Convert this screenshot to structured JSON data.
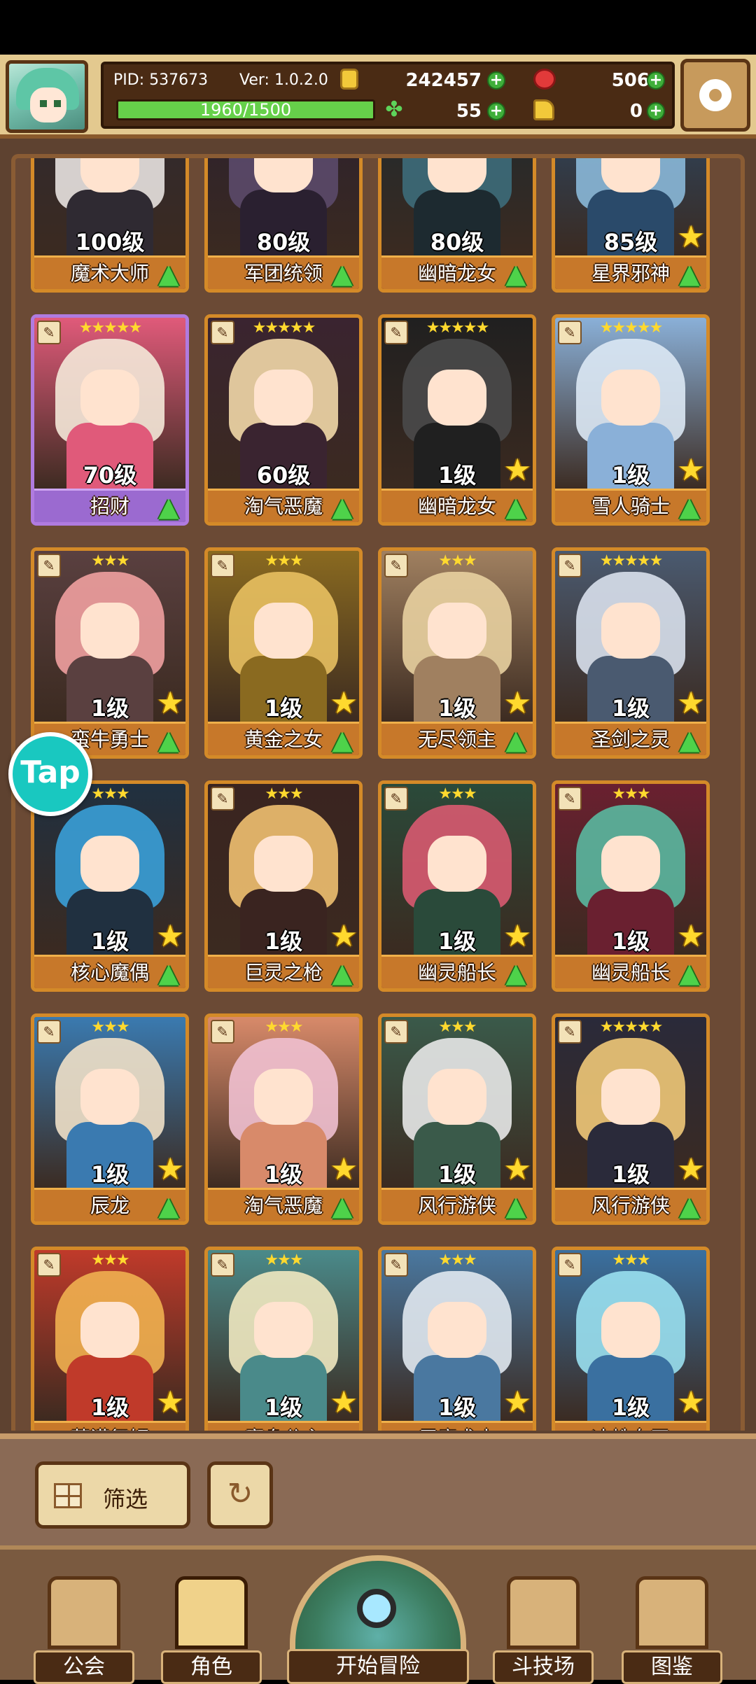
{
  "header": {
    "pid": "PID: 537673",
    "version": "Ver: 1.0.2.0",
    "gold": "242457",
    "gems": "506",
    "exp_text": "1960/1500",
    "exp_progress": 1.0,
    "clover": "55",
    "hand": "0",
    "icons": [
      "gold-coin-icon",
      "red-gem-icon",
      "clover-icon",
      "hand-icon",
      "settings-gear-icon"
    ]
  },
  "cards": [
    {
      "level": "100级",
      "name": "魔术大师",
      "stars": "",
      "colors": [
        "#e8e2e0",
        "#2f2a32"
      ],
      "frame": "orange",
      "star_badge": false
    },
    {
      "level": "80级",
      "name": "军团统领",
      "stars": "",
      "colors": [
        "#5b4a6a",
        "#2a2030"
      ],
      "frame": "orange",
      "star_badge": false
    },
    {
      "level": "80级",
      "name": "幽暗龙女",
      "stars": "",
      "colors": [
        "#3d6c7a",
        "#1d2a30"
      ],
      "frame": "orange",
      "star_badge": false
    },
    {
      "level": "85级",
      "name": "星界邪神",
      "stars": "",
      "colors": [
        "#8ab8d8",
        "#2a4a6a"
      ],
      "frame": "orange",
      "star_badge": true
    },
    {
      "level": "70级",
      "name": "招财",
      "stars": "★★★★★",
      "colors": [
        "#f4e8d8",
        "#e05a7a"
      ],
      "frame": "purple",
      "star_badge": false
    },
    {
      "level": "60级",
      "name": "淘气恶魔",
      "stars": "★★★★★",
      "colors": [
        "#f2d8a8",
        "#3a2430"
      ],
      "frame": "orange",
      "star_badge": false
    },
    {
      "level": "1级",
      "name": "幽暗龙女",
      "stars": "★★★★★",
      "colors": [
        "#4a4a4a",
        "#202020"
      ],
      "frame": "orange",
      "star_badge": true
    },
    {
      "level": "1级",
      "name": "雪人骑士",
      "stars": "★★★★★",
      "colors": [
        "#dce8f4",
        "#8ab0d8"
      ],
      "frame": "orange",
      "star_badge": true
    },
    {
      "level": "1级",
      "name": "蛮牛勇士",
      "stars": "★★★",
      "colors": [
        "#f0a0a0",
        "#5a4040"
      ],
      "frame": "orange",
      "star_badge": true
    },
    {
      "level": "1级",
      "name": "黄金之女",
      "stars": "★★★",
      "colors": [
        "#e8c060",
        "#8a6a20"
      ],
      "frame": "orange",
      "star_badge": true
    },
    {
      "level": "1级",
      "name": "无尽领主",
      "stars": "★★★",
      "colors": [
        "#e8d0a0",
        "#a08060"
      ],
      "frame": "orange",
      "star_badge": true
    },
    {
      "level": "1级",
      "name": "圣剑之灵",
      "stars": "★★★★★",
      "colors": [
        "#d8e0ec",
        "#4a5a70"
      ],
      "frame": "orange",
      "star_badge": true
    },
    {
      "level": "1级",
      "name": "核心魔偶",
      "stars": "★★★",
      "colors": [
        "#3aa0d8",
        "#203040"
      ],
      "frame": "orange",
      "star_badge": true
    },
    {
      "level": "1级",
      "name": "巨灵之枪",
      "stars": "★★★",
      "colors": [
        "#f0c070",
        "#3a2420"
      ],
      "frame": "orange",
      "star_badge": true
    },
    {
      "level": "1级",
      "name": "幽灵船长",
      "stars": "★★★",
      "colors": [
        "#d85a70",
        "#2a4a3a"
      ],
      "frame": "orange",
      "star_badge": true
    },
    {
      "level": "1级",
      "name": "幽灵船长",
      "stars": "★★★",
      "colors": [
        "#5ab8a0",
        "#6a2030"
      ],
      "frame": "orange",
      "star_badge": true
    },
    {
      "level": "1级",
      "name": "辰龙",
      "stars": "★★★",
      "colors": [
        "#f0e0c8",
        "#3a7ab0"
      ],
      "frame": "orange",
      "star_badge": true
    },
    {
      "level": "1级",
      "name": "淘气恶魔",
      "stars": "★★★",
      "colors": [
        "#f0c0d0",
        "#d88a6a"
      ],
      "frame": "orange",
      "star_badge": true
    },
    {
      "level": "1级",
      "name": "风行游侠",
      "stars": "★★★",
      "colors": [
        "#e8e8e8",
        "#3a5a4a"
      ],
      "frame": "orange",
      "star_badge": true
    },
    {
      "level": "1级",
      "name": "风行游侠",
      "stars": "★★★★★",
      "colors": [
        "#f0c878",
        "#2a2a3a"
      ],
      "frame": "orange",
      "star_badge": true
    },
    {
      "level": "1级",
      "name": "荒漠舞姬",
      "stars": "★★★",
      "colors": [
        "#f0b050",
        "#c03a2a"
      ],
      "frame": "orange",
      "star_badge": true
    },
    {
      "level": "1级",
      "name": "鹰身公主",
      "stars": "★★★",
      "colors": [
        "#f0e8c0",
        "#4a8a8a"
      ],
      "frame": "orange",
      "star_badge": true
    },
    {
      "level": "1级",
      "name": "巨魔术士",
      "stars": "★★★",
      "colors": [
        "#e0e8f0",
        "#4a78a0"
      ],
      "frame": "orange",
      "star_badge": true
    },
    {
      "level": "1级",
      "name": "冰蛛女王",
      "stars": "★★★",
      "colors": [
        "#9ae0f0",
        "#3a70a0"
      ],
      "frame": "orange",
      "star_badge": true
    }
  ],
  "tap_button": "Tap",
  "filter": {
    "label": "筛选"
  },
  "nav": {
    "guild": "公会",
    "character": "角色",
    "adventure": "开始冒险",
    "arena": "斗技场",
    "codex": "图鉴"
  }
}
